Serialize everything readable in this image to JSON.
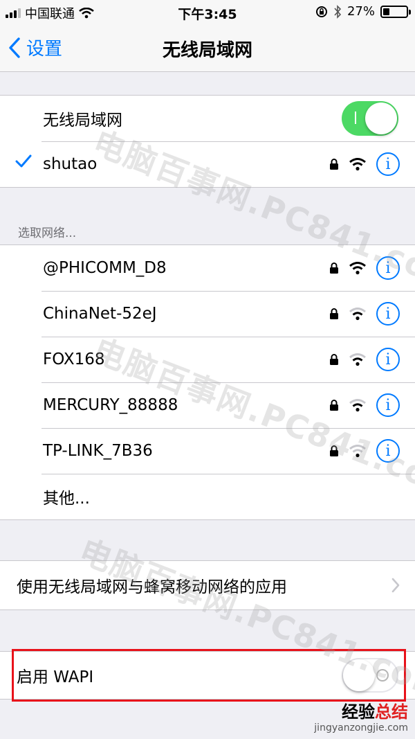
{
  "status_bar": {
    "carrier": "中国联通",
    "time": "下午3:45",
    "battery": "27%",
    "battery_level": 0.27
  },
  "nav": {
    "back_label": "设置",
    "title": "无线局域网"
  },
  "wlan_toggle": {
    "label": "无线局域网",
    "state": "on"
  },
  "connected_network": {
    "name": "shutao",
    "secured": true,
    "signal": 3
  },
  "section_header": "选取网络...",
  "networks": [
    {
      "name": "@PHICOMM_D8",
      "secured": true,
      "signal": 3
    },
    {
      "name": "ChinaNet-52eJ",
      "secured": true,
      "signal": 2
    },
    {
      "name": "FOX168",
      "secured": true,
      "signal": 2
    },
    {
      "name": "MERCURY_88888",
      "secured": true,
      "signal": 2
    },
    {
      "name": "TP-LINK_7B36",
      "secured": true,
      "signal": 1
    }
  ],
  "other_label": "其他...",
  "apps_row_label": "使用无线局域网与蜂窝移动网络的应用",
  "wapi": {
    "label": "启用 WAPI",
    "state": "off"
  },
  "watermark_text": "电脑百事网.PC841.com",
  "logo": {
    "main_a": "经验",
    "main_b": "总结",
    "sub": "jingyanzongjie.com"
  },
  "colors": {
    "accent_blue": "#007aff",
    "toggle_green": "#4cd964",
    "highlight_red": "#e8121a"
  }
}
